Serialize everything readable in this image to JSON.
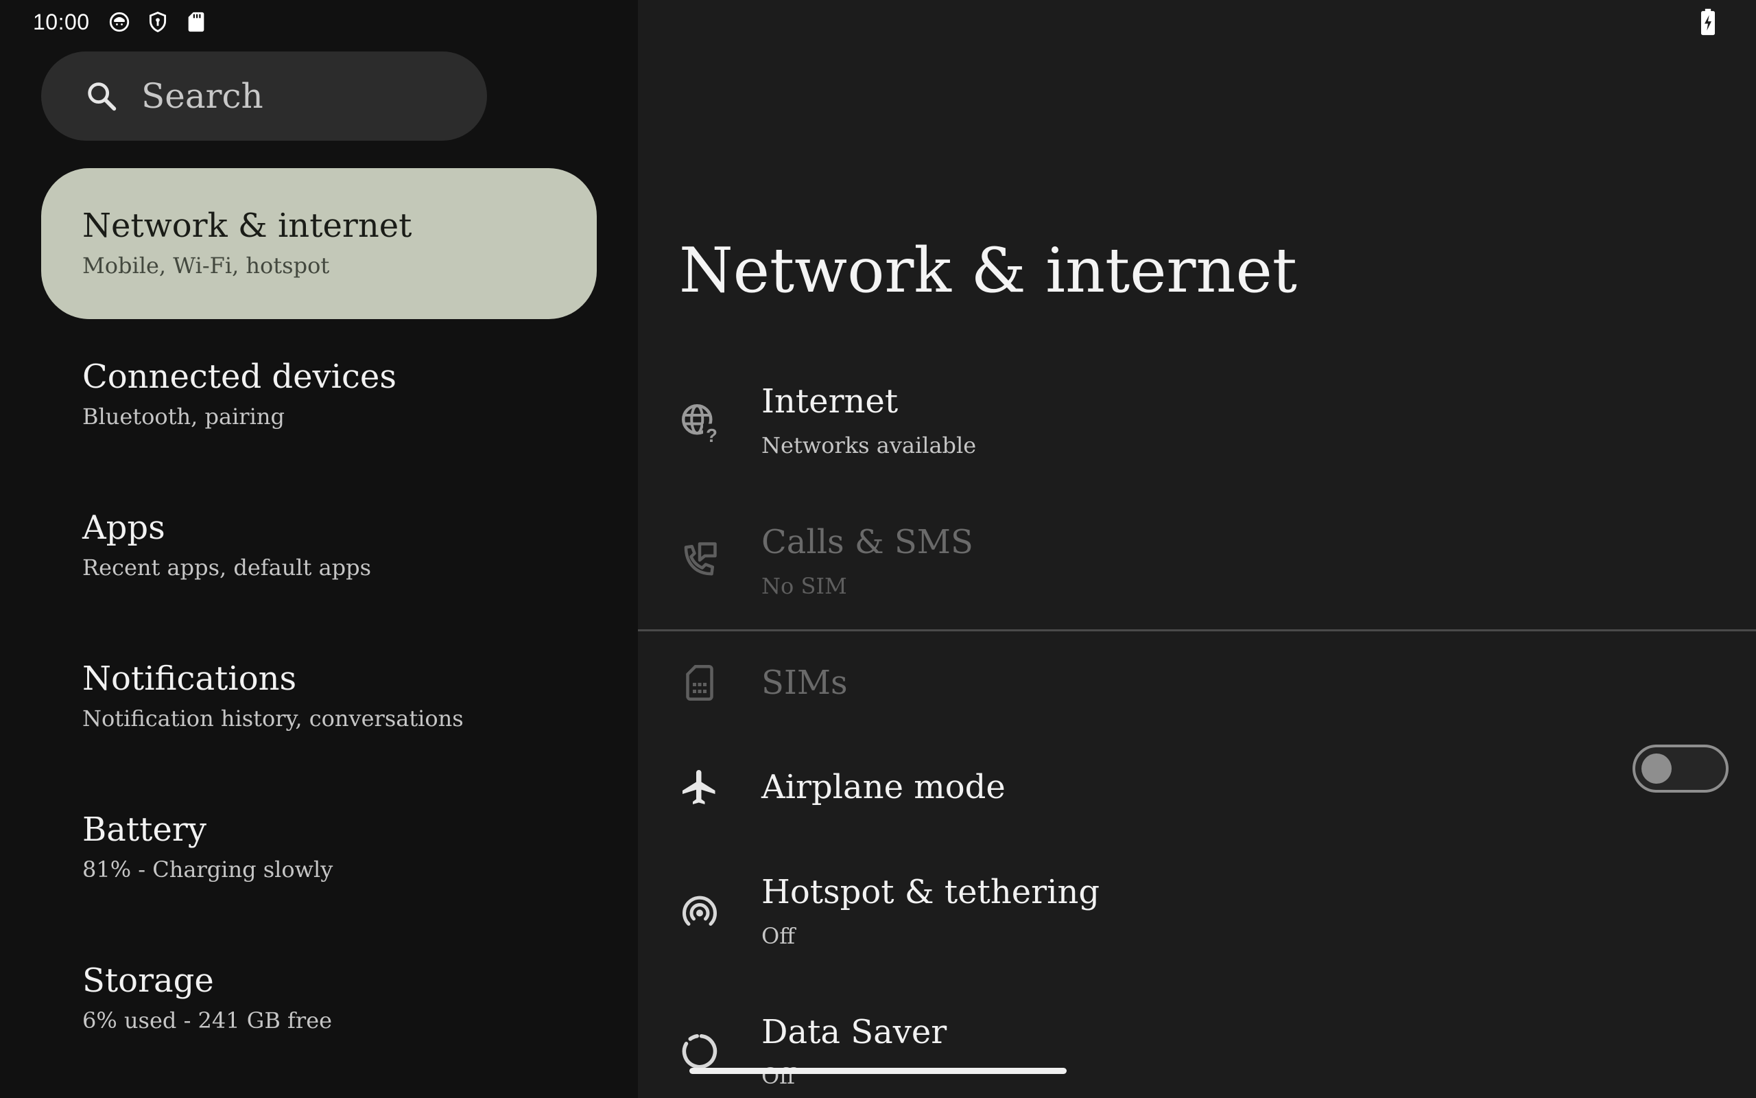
{
  "status_bar": {
    "time": "10:00",
    "icons": [
      "face-notification-icon",
      "shield-vpn-icon",
      "sd-card-icon",
      "battery-charging-icon"
    ]
  },
  "search": {
    "placeholder": "Search"
  },
  "sidebar": {
    "items": [
      {
        "title": "Network & internet",
        "subtitle": "Mobile, Wi-Fi, hotspot",
        "selected": true
      },
      {
        "title": "Connected devices",
        "subtitle": "Bluetooth, pairing"
      },
      {
        "title": "Apps",
        "subtitle": "Recent apps, default apps"
      },
      {
        "title": "Notifications",
        "subtitle": "Notification history, conversations"
      },
      {
        "title": "Battery",
        "subtitle": "81% - Charging slowly"
      },
      {
        "title": "Storage",
        "subtitle": "6% used - 241 GB free"
      }
    ]
  },
  "main": {
    "title": "Network & internet",
    "settings": [
      {
        "title": "Internet",
        "subtitle": "Networks available",
        "icon": "globe-question-icon",
        "enabled": true
      },
      {
        "title": "Calls & SMS",
        "subtitle": "No SIM",
        "icon": "phone-message-icon",
        "enabled": false
      },
      {
        "title": "SIMs",
        "icon": "sim-card-icon",
        "enabled": false
      },
      {
        "title": "Airplane mode",
        "icon": "airplane-icon",
        "enabled": true,
        "toggle_on": false
      },
      {
        "title": "Hotspot & tethering",
        "subtitle": "Off",
        "icon": "hotspot-icon",
        "enabled": true
      },
      {
        "title": "Data Saver",
        "subtitle": "Off",
        "icon": "data-saver-icon",
        "enabled": true
      }
    ]
  },
  "colors": {
    "left_background": "#111111",
    "right_background": "#1c1c1c",
    "selected_item": "#c3c8b8",
    "search_background": "#2c2c2c",
    "text_primary": "#f2f2f2",
    "text_secondary": "#c6c6c6",
    "text_disabled": "#6a6a6a"
  }
}
